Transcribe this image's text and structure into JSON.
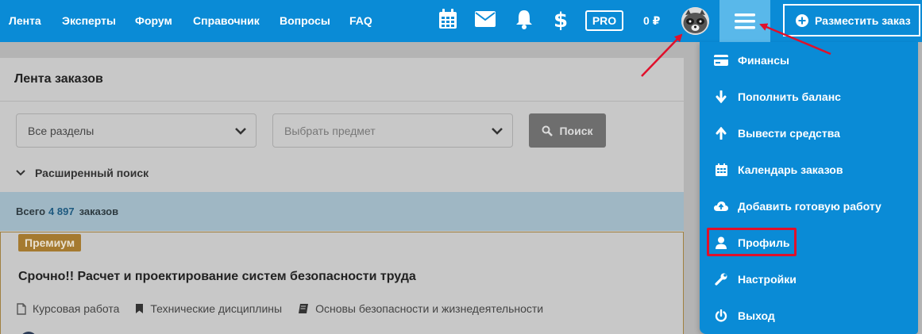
{
  "topbar": {
    "nav": [
      "Лента",
      "Эксперты",
      "Форум",
      "Справочник",
      "Вопросы",
      "FAQ"
    ],
    "pro_label": "PRO",
    "balance": "0 ₽",
    "order_button": "Разместить заказ",
    "icons": [
      "calendar-icon",
      "mail-icon",
      "bell-icon",
      "dollar-icon",
      "hamburger-menu-icon"
    ]
  },
  "feed": {
    "title": "Лента заказов",
    "section_select": "Все разделы",
    "subject_placeholder": "Выбрать предмет",
    "search_button": "Поиск",
    "advanced_search": "Расширенный поиск",
    "total_prefix": "Всего",
    "total_count": "4 897",
    "total_suffix": "заказов"
  },
  "order_card": {
    "badge": "Премиум",
    "title": "Срочно!! Расчет и проектирование систем безопасности труда",
    "type": "Курсовая работа",
    "discipline": "Технические дисциплины",
    "subject": "Основы безопасности и жизнедеятельности"
  },
  "menu": {
    "items": [
      "Финансы",
      "Пополнить баланс",
      "Вывести средства",
      "Календарь заказов",
      "Добавить готовую работу",
      "Профиль",
      "Настройки",
      "Выход"
    ]
  },
  "colors": {
    "primary": "#0a8bd6",
    "menu_active": "#59b8ea",
    "highlight": "#e0102b",
    "premium": "#a57a30"
  }
}
